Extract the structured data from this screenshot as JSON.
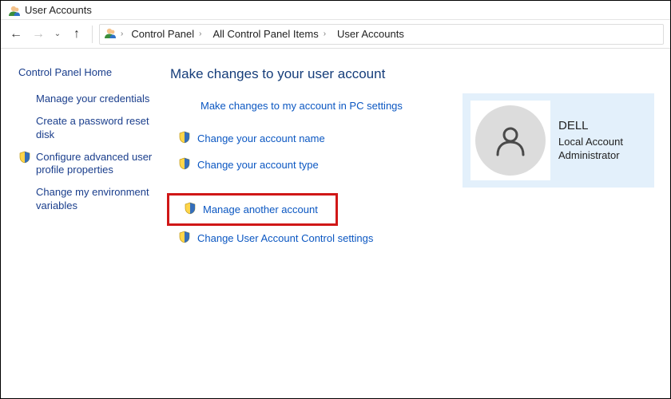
{
  "window": {
    "title": "User Accounts"
  },
  "breadcrumbs": {
    "items": [
      "Control Panel",
      "All Control Panel Items",
      "User Accounts"
    ]
  },
  "sidebar": {
    "heading": "Control Panel Home",
    "items": [
      {
        "label": "Manage your credentials",
        "shield": false
      },
      {
        "label": "Create a password reset disk",
        "shield": false
      },
      {
        "label": "Configure advanced user profile properties",
        "shield": true
      },
      {
        "label": "Change my environment variables",
        "shield": false
      }
    ]
  },
  "main": {
    "title": "Make changes to your user account",
    "pc_settings_link": "Make changes to my account in PC settings",
    "actions_group1": [
      {
        "label": "Change your account name"
      },
      {
        "label": "Change your account type"
      }
    ],
    "highlight_action": {
      "label": "Manage another account"
    },
    "actions_group2": [
      {
        "label": "Change User Account Control settings"
      }
    ]
  },
  "user": {
    "name": "DELL",
    "type": "Local Account",
    "role": "Administrator"
  }
}
